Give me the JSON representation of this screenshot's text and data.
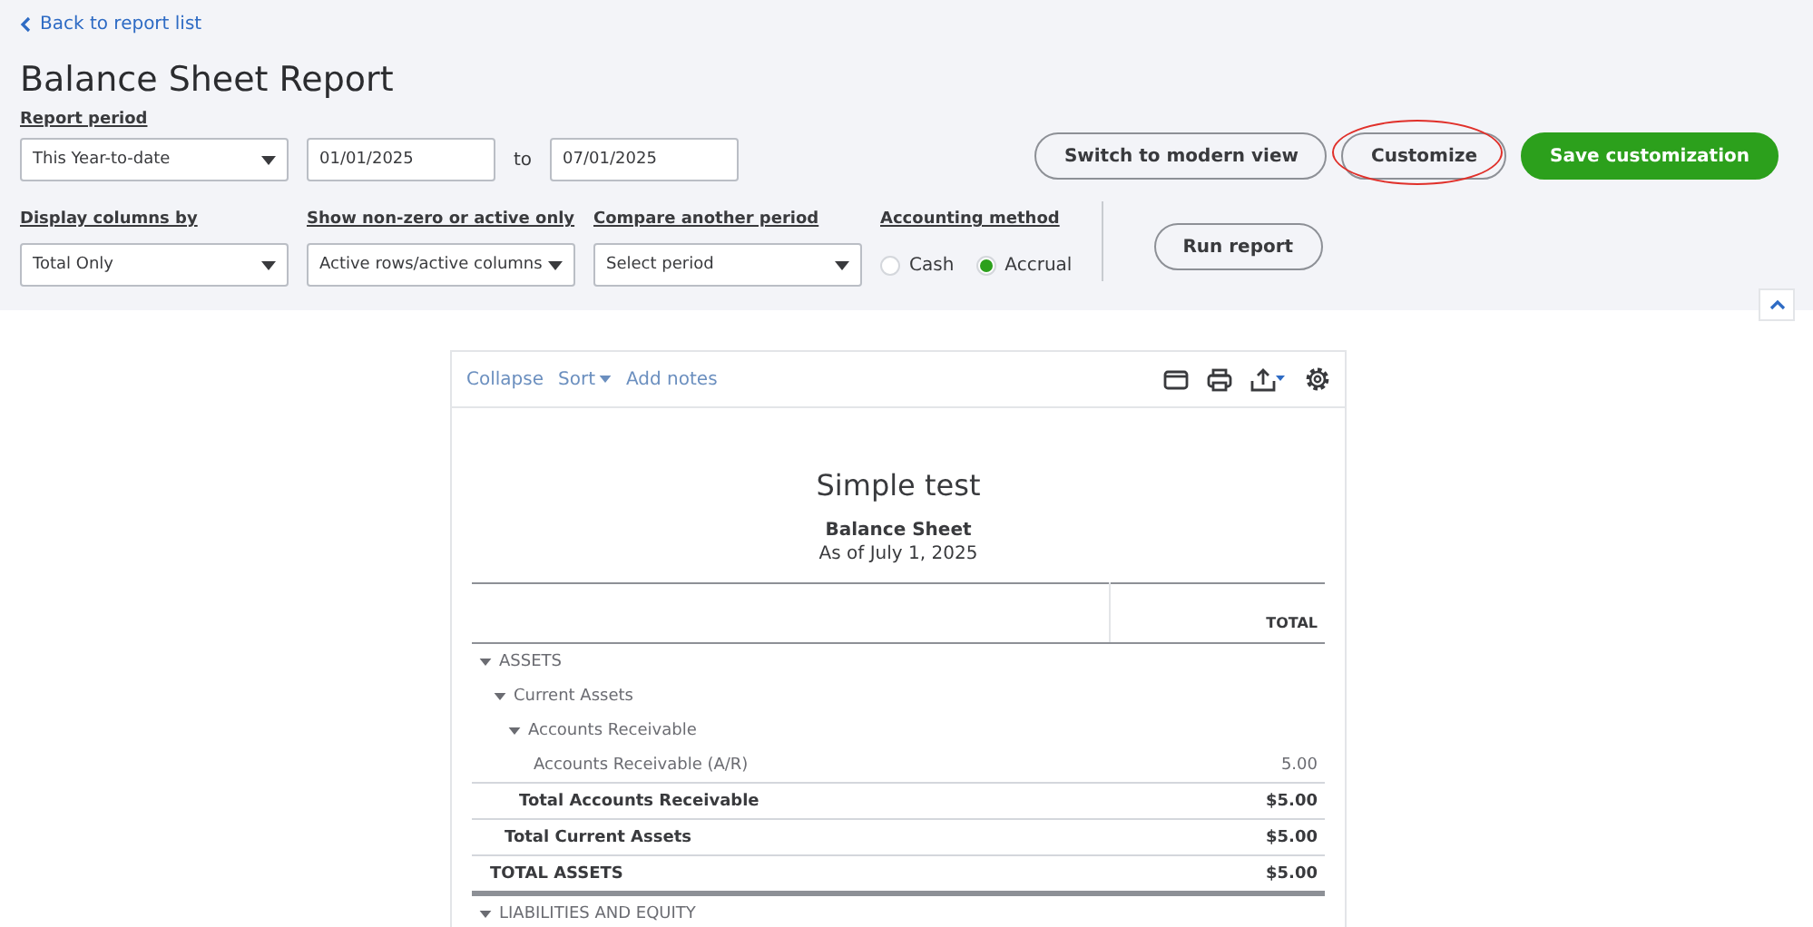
{
  "back_link": "Back to report list",
  "title": "Balance Sheet Report",
  "report_period": {
    "label": "Report period",
    "value": "This Year-to-date",
    "from": "01/01/2025",
    "separator": "to",
    "to": "07/01/2025"
  },
  "header_buttons": [
    {
      "label": "Switch to modern view",
      "kind": "outline",
      "highlighted": false
    },
    {
      "label": "Customize",
      "kind": "outline",
      "highlighted": true
    },
    {
      "label": "Save customization",
      "kind": "primary",
      "highlighted": false
    }
  ],
  "filters": [
    {
      "label": "Display columns by",
      "value": "Total Only"
    },
    {
      "label": "Show non-zero or active only",
      "value": "Active rows/active columns"
    },
    {
      "label": "Compare another period",
      "value": "Select period"
    }
  ],
  "accounting_method": {
    "label": "Accounting method",
    "options": [
      {
        "label": "Cash",
        "selected": false
      },
      {
        "label": "Accrual",
        "selected": true
      }
    ]
  },
  "run_button": "Run report",
  "report": {
    "toolbar": [
      "Collapse",
      "Sort",
      "Add notes"
    ],
    "company": "Simple test",
    "name": "Balance Sheet",
    "date": "As of July 1, 2025",
    "column": "TOTAL",
    "rows": [
      {
        "label": "ASSETS",
        "expanded": true,
        "children": [
          {
            "label": "Current Assets",
            "expanded": true,
            "children": [
              {
                "label": "Accounts Receivable",
                "expanded": true,
                "children": [
                  {
                    "label": "Accounts Receivable (A/R)",
                    "amount": "5.00"
                  }
                ],
                "total": {
                  "label": "Total Accounts Receivable",
                  "amount": "$5.00"
                }
              }
            ],
            "total": {
              "label": "Total Current Assets",
              "amount": "$5.00"
            }
          }
        ],
        "total": {
          "label": "TOTAL ASSETS",
          "amount": "$5.00"
        }
      },
      {
        "label": "LIABILITIES AND EQUITY",
        "expanded": true,
        "children": []
      }
    ]
  }
}
